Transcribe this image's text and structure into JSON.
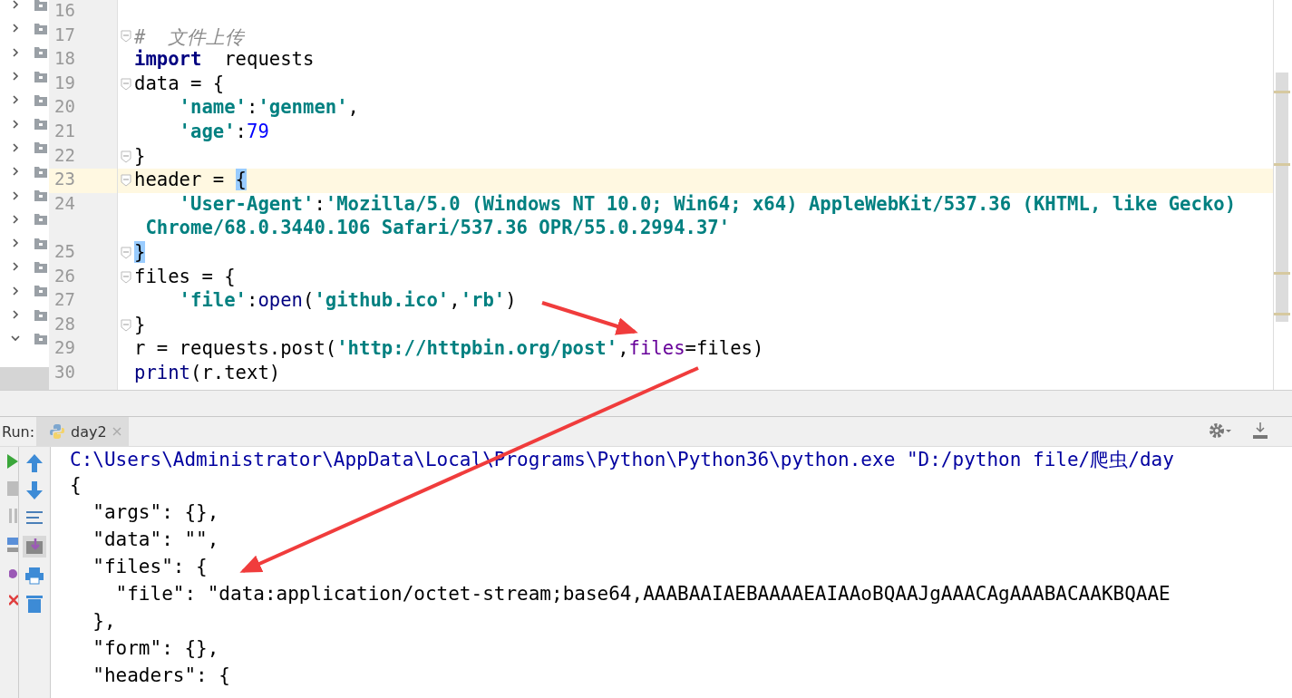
{
  "project_tree": {
    "items": [
      {
        "expanded": false
      },
      {
        "expanded": false
      },
      {
        "expanded": false
      },
      {
        "expanded": false
      },
      {
        "expanded": false
      },
      {
        "expanded": false
      },
      {
        "expanded": false
      },
      {
        "expanded": false
      },
      {
        "expanded": false
      },
      {
        "expanded": false
      },
      {
        "expanded": false
      },
      {
        "expanded": false
      },
      {
        "expanded": false
      },
      {
        "expanded": false
      },
      {
        "expanded": true
      }
    ]
  },
  "editor": {
    "lines": [
      {
        "number": "16",
        "current": false
      },
      {
        "number": "17",
        "current": false,
        "fold": true,
        "tokens": [
          {
            "kind": "comment",
            "text": "#  文件上传"
          }
        ]
      },
      {
        "number": "18",
        "current": false,
        "tokens": [
          {
            "kind": "keyword",
            "text": "import"
          },
          {
            "kind": "plain",
            "text": "  requests"
          }
        ]
      },
      {
        "number": "19",
        "current": false,
        "fold": true,
        "tokens": [
          {
            "kind": "plain",
            "text": "data = {"
          }
        ]
      },
      {
        "number": "20",
        "current": false,
        "tokens": [
          {
            "kind": "string",
            "text": "    'name'"
          },
          {
            "kind": "plain",
            "text": ":"
          },
          {
            "kind": "string",
            "text": "'genmen'"
          },
          {
            "kind": "plain",
            "text": ","
          }
        ]
      },
      {
        "number": "21",
        "current": false,
        "tokens": [
          {
            "kind": "string",
            "text": "    'age'"
          },
          {
            "kind": "plain",
            "text": ":"
          },
          {
            "kind": "number",
            "text": "79"
          }
        ]
      },
      {
        "number": "22",
        "current": false,
        "fold": true,
        "tokens": [
          {
            "kind": "plain",
            "text": "}"
          }
        ]
      },
      {
        "number": "23",
        "current": true,
        "fold": true,
        "tokens": [
          {
            "kind": "plain",
            "text": "header = "
          },
          {
            "kind": "match",
            "text": "{"
          }
        ]
      },
      {
        "number": "24",
        "current": false,
        "tokens": [
          {
            "kind": "string",
            "text": "    'User-Agent'"
          },
          {
            "kind": "plain",
            "text": ":"
          },
          {
            "kind": "string",
            "text": "'Mozilla/5.0 (Windows NT 10.0; Win64; x64) AppleWebKit/537.36 (KHTML, like Gecko)"
          }
        ]
      },
      {
        "current": false,
        "tokens": [
          {
            "kind": "string",
            "text": " Chrome/68.0.3440.106 Safari/537.36 OPR/55.0.2994.37'"
          }
        ]
      },
      {
        "number": "25",
        "current": false,
        "fold": true,
        "tokens": [
          {
            "kind": "match",
            "text": "}"
          }
        ]
      },
      {
        "number": "26",
        "current": false,
        "fold": true,
        "tokens": [
          {
            "kind": "plain",
            "text": "files = {"
          }
        ]
      },
      {
        "number": "27",
        "current": false,
        "tokens": [
          {
            "kind": "string",
            "text": "    'file'"
          },
          {
            "kind": "plain",
            "text": ":"
          },
          {
            "kind": "builtin",
            "text": "open"
          },
          {
            "kind": "plain",
            "text": "("
          },
          {
            "kind": "string",
            "text": "'github.ico'"
          },
          {
            "kind": "plain",
            "text": ","
          },
          {
            "kind": "string",
            "text": "'rb'"
          },
          {
            "kind": "plain",
            "text": ")"
          }
        ]
      },
      {
        "number": "28",
        "current": false,
        "fold": true,
        "tokens": [
          {
            "kind": "plain",
            "text": "}"
          }
        ]
      },
      {
        "number": "29",
        "current": false,
        "tokens": [
          {
            "kind": "plain",
            "text": "r = requests.post("
          },
          {
            "kind": "string",
            "text": "'http://httpbin.org/post'"
          },
          {
            "kind": "plain",
            "text": ","
          },
          {
            "kind": "param",
            "text": "files"
          },
          {
            "kind": "plain",
            "text": "=files)"
          }
        ]
      },
      {
        "number": "30",
        "current": false,
        "tokens": [
          {
            "kind": "builtin",
            "text": "print"
          },
          {
            "kind": "plain",
            "text": "(r.text)"
          }
        ]
      }
    ]
  },
  "run_panel": {
    "label": "Run:",
    "tabs": [
      {
        "label": "day2",
        "selected": true
      }
    ],
    "console": [
      {
        "kind": "command",
        "text": "C:\\Users\\Administrator\\AppData\\Local\\Programs\\Python\\Python36\\python.exe \"D:/python file/爬虫/day"
      },
      {
        "kind": "output",
        "text": "{"
      },
      {
        "kind": "output",
        "text": "  \"args\": {},"
      },
      {
        "kind": "output",
        "text": "  \"data\": \"\","
      },
      {
        "kind": "output",
        "text": "  \"files\": {"
      },
      {
        "kind": "output",
        "text": "    \"file\": \"data:application/octet-stream;base64,AAABAAIAEBAAAAEAIAAoBQAAJgAAACAgAAABACAAKBQAAE"
      },
      {
        "kind": "output",
        "text": "  },"
      },
      {
        "kind": "output",
        "text": "  \"form\": {},"
      },
      {
        "kind": "output",
        "text": "  \"headers\": {"
      }
    ]
  }
}
